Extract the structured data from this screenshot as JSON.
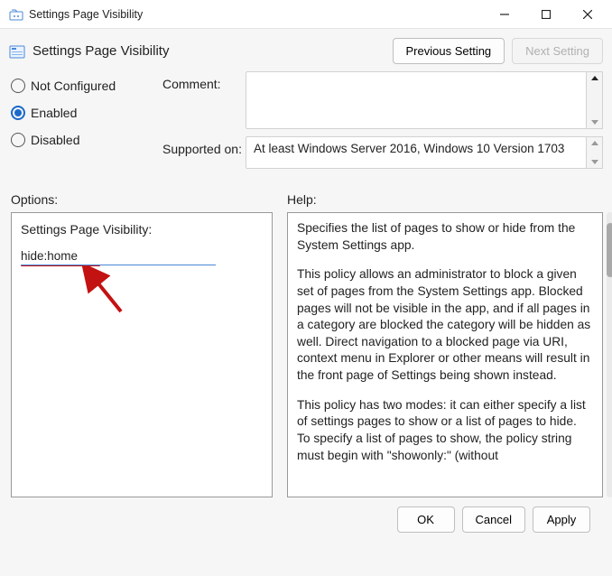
{
  "window": {
    "title": "Settings Page Visibility"
  },
  "header": {
    "title": "Settings Page Visibility",
    "prev": "Previous Setting",
    "next": "Next Setting"
  },
  "radios": {
    "not_configured": "Not Configured",
    "enabled": "Enabled",
    "disabled": "Disabled",
    "selected": "enabled"
  },
  "labels": {
    "comment": "Comment:",
    "supported": "Supported on:",
    "options": "Options:",
    "help": "Help:"
  },
  "supported_text": "At least Windows Server 2016, Windows 10 Version 1703",
  "options": {
    "title": "Settings Page Visibility:",
    "value": "hide:home"
  },
  "help": {
    "p1": "Specifies the list of pages to show or hide from the System Settings app.",
    "p2": "This policy allows an administrator to block a given set of pages from the System Settings app. Blocked pages will not be visible in the app, and if all pages in a category are blocked the category will be hidden as well. Direct navigation to a blocked page via URI, context menu in Explorer or other means will result in the front page of Settings being shown instead.",
    "p3": "This policy has two modes: it can either specify a list of settings pages to show or a list of pages to hide. To specify a list of pages to show, the policy string must begin with \"showonly:\" (without"
  },
  "footer": {
    "ok": "OK",
    "cancel": "Cancel",
    "apply": "Apply"
  }
}
